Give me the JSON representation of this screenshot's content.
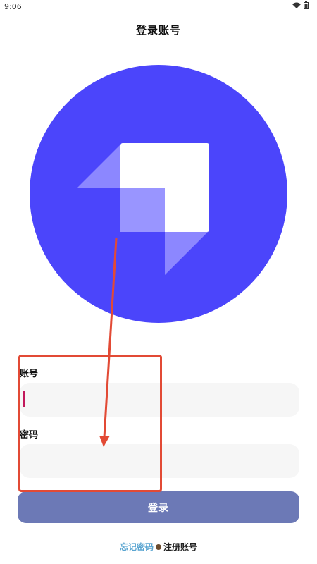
{
  "status_bar": {
    "time": "9:06"
  },
  "title": "登录账号",
  "form": {
    "account_label": "账号",
    "account_value": "",
    "password_label": "密码",
    "password_value": ""
  },
  "login_button_label": "登录",
  "links": {
    "forgot_password": "忘记密码",
    "register": "注册账号"
  },
  "colors": {
    "logo_circle": "#4b45fb",
    "button": "#6c79b6",
    "annotation": "#e24a35",
    "forgot_link": "#5aa5d1"
  },
  "icons": [
    "wifi-icon",
    "battery-icon",
    "app-logo-icon"
  ]
}
